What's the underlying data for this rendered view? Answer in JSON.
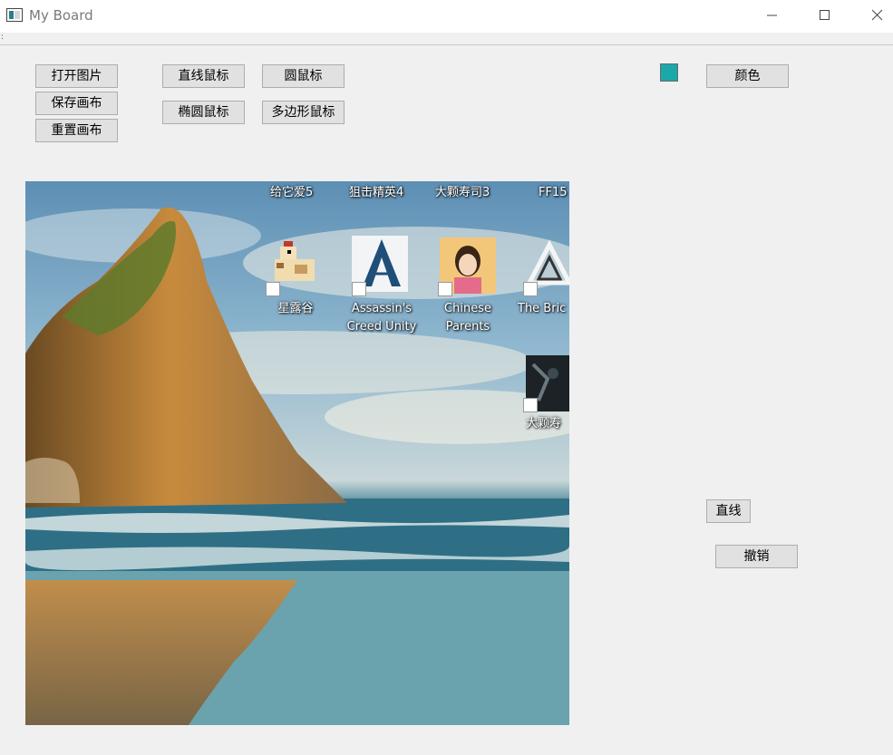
{
  "window": {
    "title": "My Board",
    "controls": {
      "minimize": "minimize-icon",
      "maximize": "maximize-icon",
      "close": "close-icon"
    }
  },
  "toolbar": {
    "open_image": "打开图片",
    "save_canvas": "保存画布",
    "reset_canvas": "重置画布",
    "line_mouse": "直线鼠标",
    "circle_mouse": "圆鼠标",
    "ellipse_mouse": "椭圆鼠标",
    "polygon_mouse": "多边形鼠标",
    "color": "颜色",
    "current_color": "#1aa8a8"
  },
  "side": {
    "line": "直线",
    "undo": "撤销"
  },
  "canvas": {
    "top_labels": [
      "给它爱5",
      "狙击精英4",
      "大颗寿司3",
      "FF15"
    ],
    "icons": [
      {
        "name": "星露谷",
        "icon": "stardew-chicken-icon"
      },
      {
        "name": "Assassin's Creed Unity",
        "line1": "Assassin's",
        "line2": "Creed Unity",
        "icon": "assassins-creed-icon"
      },
      {
        "name": "Chinese Parents",
        "line1": "Chinese",
        "line2": "Parents",
        "icon": "chinese-parents-icon"
      },
      {
        "name": "The Bric",
        "line1": "The Bric",
        "icon": "the-bridge-icon"
      },
      {
        "name": "大颗寿",
        "line1": "大颗寿",
        "icon": "dark-game-icon"
      }
    ]
  }
}
